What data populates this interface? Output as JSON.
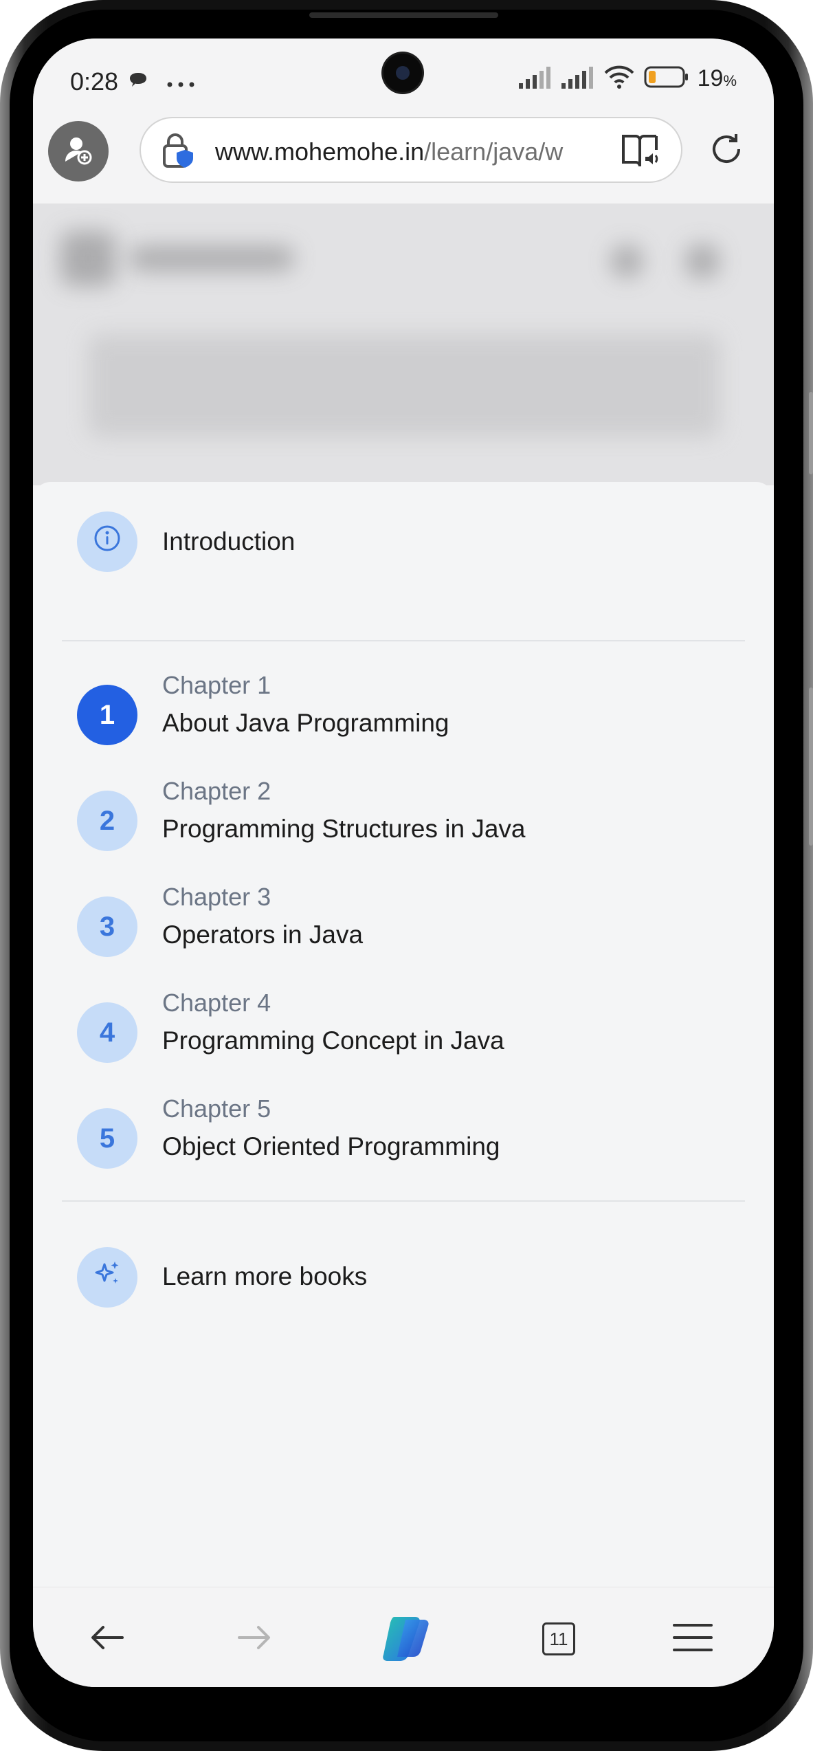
{
  "status_bar": {
    "time": "0:28",
    "battery_percent": "19",
    "battery_unit": "%"
  },
  "browser": {
    "url_domain": "www.mohemohe.in",
    "url_path": "/learn/java/w",
    "tab_count": "11"
  },
  "menu": {
    "introduction_label": "Introduction",
    "chapters": [
      {
        "number": "1",
        "label": "Chapter 1",
        "title": "About Java Programming"
      },
      {
        "number": "2",
        "label": "Chapter 2",
        "title": "Programming Structures in Java"
      },
      {
        "number": "3",
        "label": "Chapter 3",
        "title": "Operators in Java"
      },
      {
        "number": "4",
        "label": "Chapter 4",
        "title": "Programming Concept in Java"
      },
      {
        "number": "5",
        "label": "Chapter 5",
        "title": "Object Oriented Programming"
      }
    ],
    "learn_more_label": "Learn more books"
  },
  "colors": {
    "accent": "#2360e2",
    "circle_bg": "#c6dcf8",
    "circle_text": "#3a76dc"
  }
}
